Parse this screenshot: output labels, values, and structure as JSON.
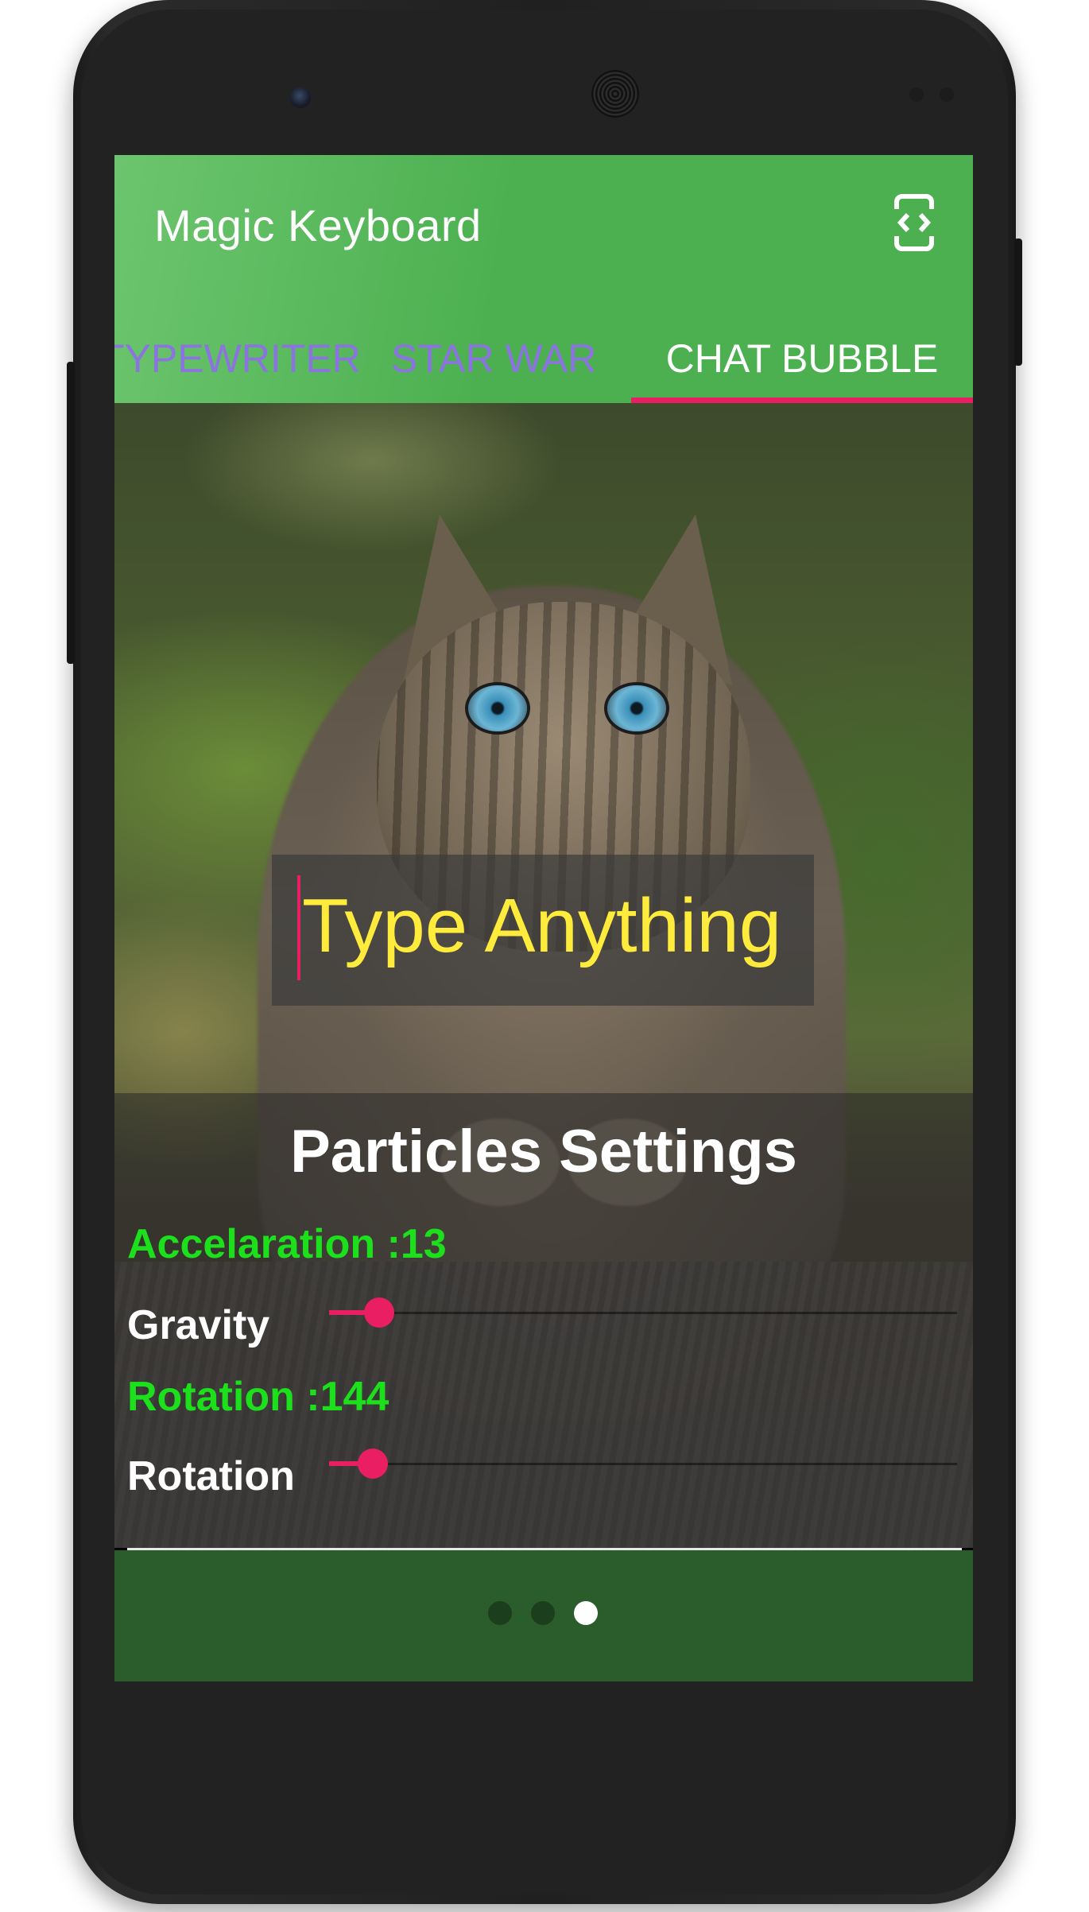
{
  "app": {
    "title": "Magic Keyboard"
  },
  "toolbar": {
    "action_icon": "code-view-icon"
  },
  "tabs": [
    {
      "label": "TYPEWRITER",
      "selected": false
    },
    {
      "label": "STAR WAR",
      "selected": false
    },
    {
      "label": "CHAT BUBBLE",
      "selected": true
    }
  ],
  "preview": {
    "input_text": "Type Anything",
    "background": "kitten photo"
  },
  "settings": {
    "title": "Particles Settings",
    "acceleration_label": "Accelaration :13",
    "gravity_label": "Gravity",
    "gravity_level": 0.08,
    "rotation_value_label": "Rotation :144",
    "rotation_label": "Rotation",
    "rotation_level": 0.07
  },
  "pager": {
    "pages": 3,
    "current": 3
  },
  "colors": {
    "primary": "#4caf50",
    "accent": "#e91e63",
    "value_text": "#1de01d",
    "input_text": "#ffeb3b",
    "inactive_tab": "#8b73e0",
    "bottom_bar": "#2b5d2c"
  }
}
